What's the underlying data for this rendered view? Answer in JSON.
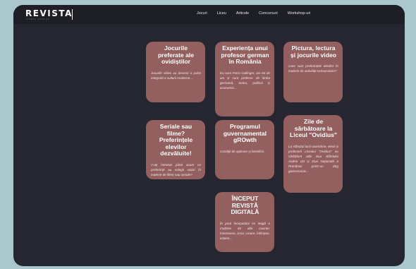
{
  "header": {
    "logo": "REVISTA",
    "logo_sub": "LICEUL OVIDIUS",
    "nav": [
      "Jocuri",
      "Liceu",
      "Articole",
      "Concursuri",
      "Workshop-uri"
    ]
  },
  "cards": [
    {
      "title": "Jocurile preferate ale ovidiștilor",
      "desc": "Jocurile video au devenit o parte integrală a culturii moderne..."
    },
    {
      "title": "Experiența unui profesor german în România",
      "desc": "Eu sunt Petra Gallinger, am 66 de ani și sunt profesor de limba germană, teatru, politică și economie..."
    },
    {
      "title": "Pictura, lectura și jocurile video",
      "desc": "Care sunt preferințele elevilor în materie de activități extrașcolare?"
    },
    {
      "title": "Seriale sau filme? Preferințele elevilor dezvăluite!",
      "desc": "V-ați întrebat până acum ce preferință au colegii voștri în materie de filme sau seriale?"
    },
    {
      "title": "Programul guvernamental gROwth",
      "desc": "Condiții de aplicare și beneficii."
    },
    {
      "title": "Zile de sărbătoare la Liceul \"Ovidius\"",
      "desc": "La sfârșitul lunii noiembrie, elevii și profesorii Liceului \"Ovidius\" au sărbătorit atât ziua Sfântului Andrei cât și Ziua Națională a României printr-un târg gastronomic..."
    },
    {
      "title": "ÎNCEPUT REVISTĂ DIGITALĂ",
      "desc": "În jurul începutului se leagă o mulțime de alte cuvinte: întemeiere, izvor, creare, înființare, inițiere..."
    }
  ],
  "colors": {
    "page_bg": "#a9c7cc",
    "frame_bg": "#262631",
    "navbar_bg": "#1e1e27",
    "card_bg": "#935f5f"
  }
}
